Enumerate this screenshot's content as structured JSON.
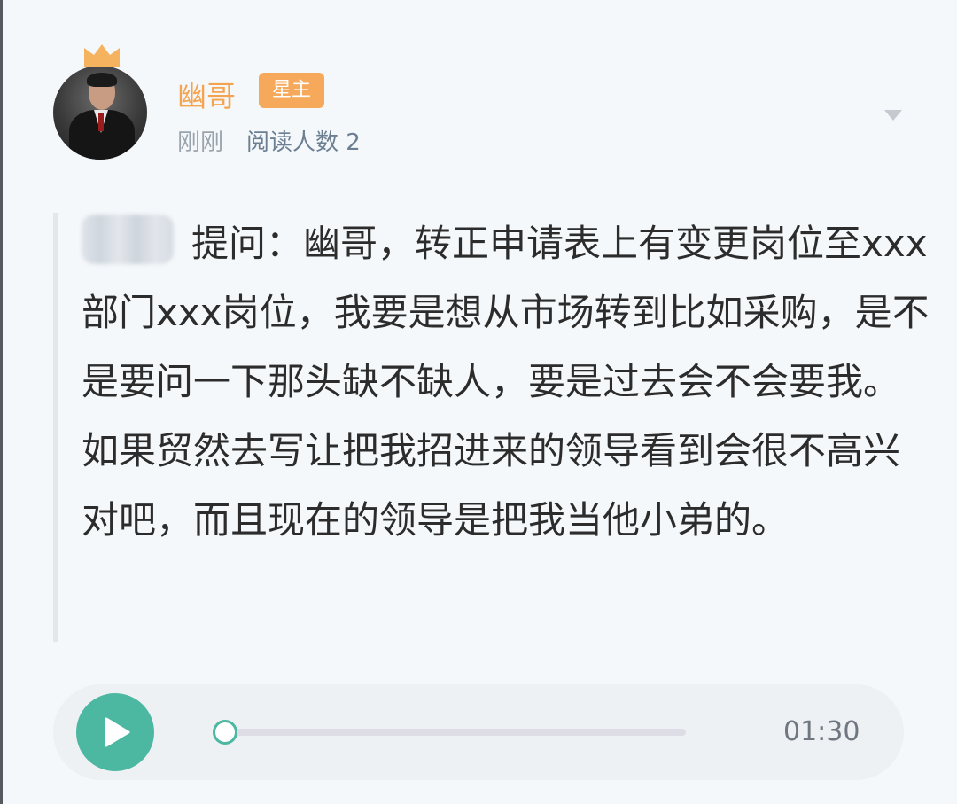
{
  "post": {
    "author": {
      "name": "幽哥",
      "badge": "星主"
    },
    "time": "刚刚",
    "readers": "阅读人数 2",
    "question": {
      "asker_blurred": true,
      "text": "提问：幽哥，转正申请表上有变更岗位至xxx部门xxx岗位，我要是想从市场转到比如采购，是不是要问一下那头缺不缺人，要是过去会不会要我。如果贸然去写让把我招进来的领导看到会很不高兴对吧，而且现在的领导是把我当他小弟的。"
    },
    "audio": {
      "duration": "01:30",
      "progress": 0
    }
  },
  "colors": {
    "name": "#f4a450",
    "badge_bg": "#f6a85b",
    "play": "#4cb8a2",
    "readers": "#6c7f92"
  },
  "icons": {
    "crown": "crown-icon",
    "menu": "chevron-down-icon",
    "play": "play-icon"
  }
}
